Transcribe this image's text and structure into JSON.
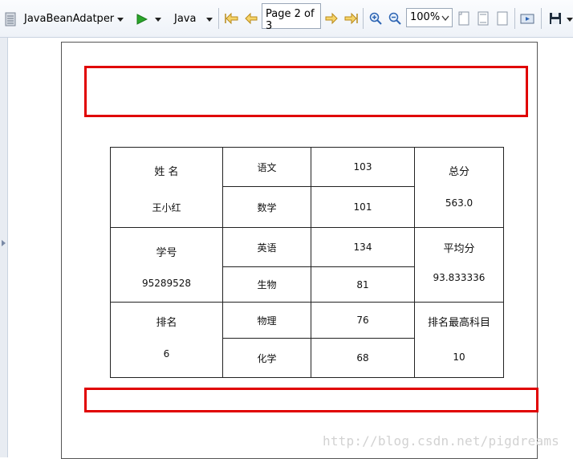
{
  "toolbar": {
    "source_label": "JavaBeanAdatper",
    "language_label": "Java",
    "page_indicator": "Page 2 of 3",
    "zoom_value": "100%",
    "icons": [
      "document-list-icon",
      "run-icon",
      "first-page-icon",
      "previous-page-icon",
      "next-page-icon",
      "last-page-icon",
      "zoom-in-icon",
      "zoom-out-icon",
      "actual-size-icon",
      "fit-page-icon",
      "fit-width-icon",
      "export-icon",
      "save-icon"
    ]
  },
  "report": {
    "col1": {
      "name_label": "姓 名",
      "name_value": "王小红",
      "id_label": "学号",
      "id_value": "95289528",
      "rank_label": "排名",
      "rank_value": "6"
    },
    "subjects": [
      {
        "name": "语文",
        "score": "103"
      },
      {
        "name": "数学",
        "score": "101"
      },
      {
        "name": "英语",
        "score": "134"
      },
      {
        "name": "生物",
        "score": "81"
      },
      {
        "name": "物理",
        "score": "76"
      },
      {
        "name": "化学",
        "score": "68"
      }
    ],
    "col4": {
      "total_label": "总分",
      "total_value": "563.0",
      "avg_label": "平均分",
      "avg_value": "93.833336",
      "top_label": "排名最高科目",
      "top_value": "10"
    }
  },
  "watermark": "http://blog.csdn.net/pigdreams",
  "colors": {
    "frame_red": "#e00000",
    "toolbar_bg": "#eef2f8"
  }
}
